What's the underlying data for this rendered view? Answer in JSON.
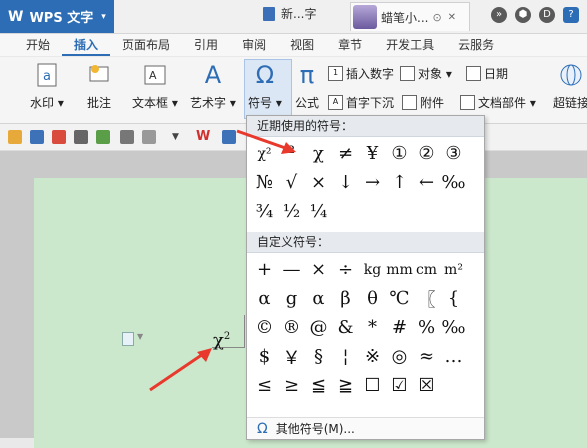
{
  "app": {
    "logo": "W",
    "name": "WPS 文字",
    "caret": "▾"
  },
  "doc_tabs": [
    {
      "label": "新...字"
    },
    {
      "label": "蜡笔小...",
      "close": "✕"
    }
  ],
  "menu_tabs": [
    "开始",
    "插入",
    "页面布局",
    "引用",
    "审阅",
    "视图",
    "章节",
    "开发工具",
    "云服务"
  ],
  "active_tab": "插入",
  "ribbon": {
    "watermark": "水印 ▾",
    "comment": "批注",
    "textbox": "文本框 ▾",
    "wordart": "艺术字 ▾",
    "symbol": "符号 ▾",
    "formula": "公式",
    "insert_number": "插入数字",
    "object": "对象 ▾",
    "date": "日期",
    "dropcap": "首字下沉",
    "attachment": "附件",
    "docparts": "文档部件 ▾",
    "hyperlink": "超链接"
  },
  "document": {
    "text": "χ",
    "sup": "2"
  },
  "symbol_panel": {
    "recent_header": "近期使用的符号：",
    "recent": [
      "χ²",
      "²",
      "χ",
      "≠",
      "¥",
      "①",
      "②",
      "③",
      "№",
      "√",
      "×",
      "↓",
      "→",
      "↑",
      "←",
      "‰",
      "¾",
      "½",
      "¼"
    ],
    "custom_header": "自定义符号：",
    "custom": [
      "+",
      "—",
      "×",
      "÷",
      "kg",
      "mm",
      "cm",
      "m²",
      "α",
      "g",
      "α",
      "β",
      "θ",
      "℃",
      "〖",
      "{",
      "©",
      "®",
      "@",
      "&",
      "*",
      "#",
      "%",
      "‰",
      "$",
      "￥",
      "§",
      "¦",
      "※",
      "◎",
      "≈",
      "…",
      "≤",
      "≥",
      "≦",
      "≧",
      "☐",
      "☑",
      "☒"
    ],
    "footer": "其他符号(M)..."
  },
  "colors": {
    "accent": "#2d6db5",
    "page_bg": "#cce8cc",
    "arrow": "#e8392c"
  }
}
